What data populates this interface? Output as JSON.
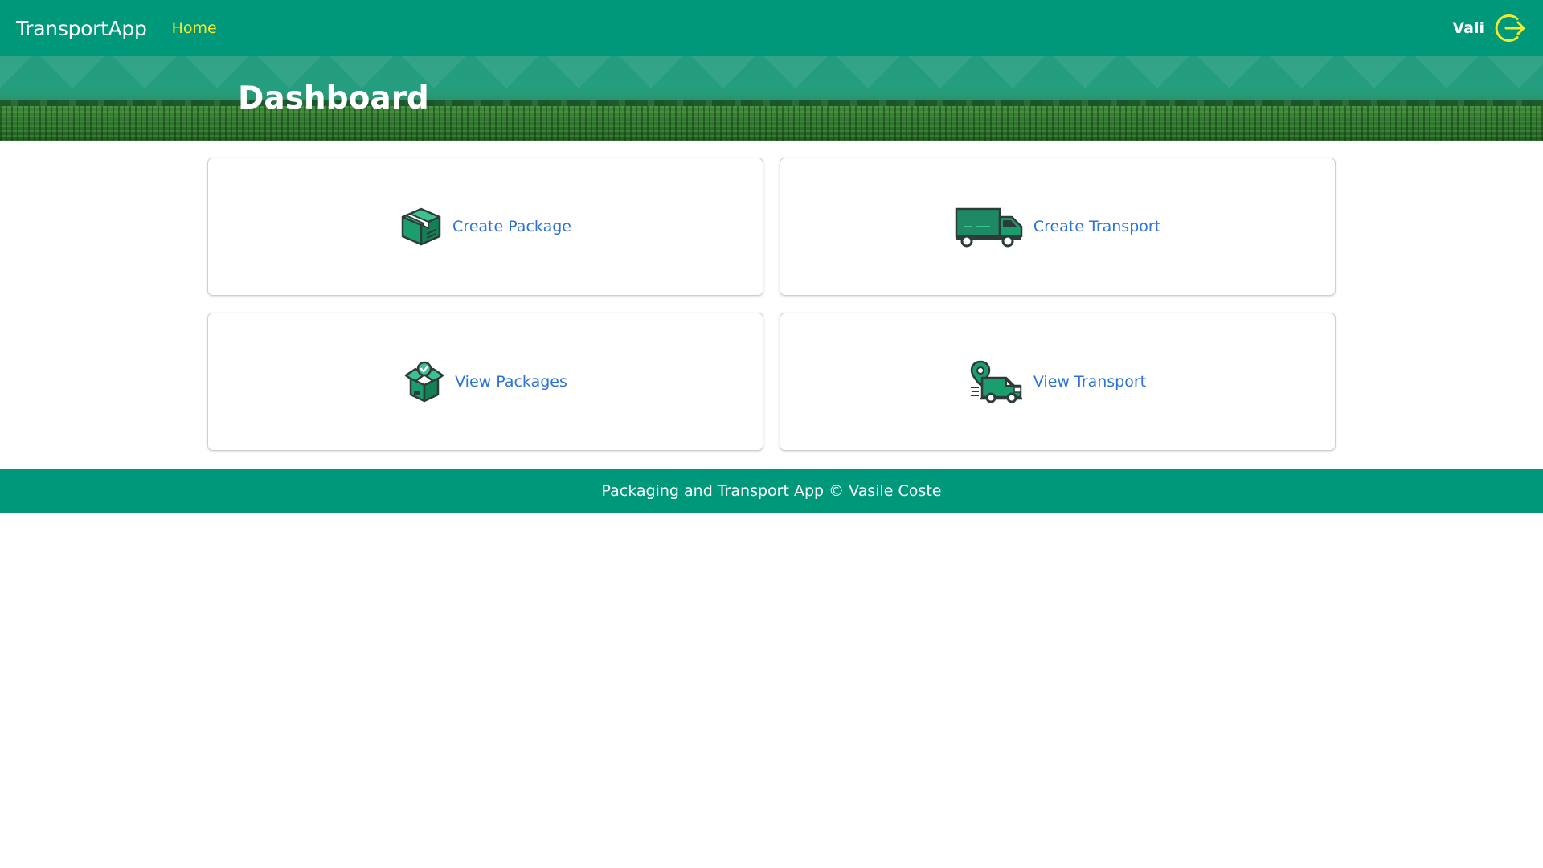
{
  "navbar": {
    "brand": "TransportApp",
    "home_label": "Home",
    "username": "Vali",
    "logout_icon": "logout-icon"
  },
  "hero": {
    "title": "Dashboard"
  },
  "cards": [
    {
      "label": "Create Package",
      "icon": "package-box-icon"
    },
    {
      "label": "Create Transport",
      "icon": "truck-icon"
    },
    {
      "label": "View Packages",
      "icon": "open-box-check-icon"
    },
    {
      "label": "View Transport",
      "icon": "delivery-van-location-icon"
    }
  ],
  "footer": {
    "text": "Packaging and Transport App © Vasile Coste"
  },
  "colors": {
    "primary": "#00987a",
    "nav_link": "#f2ea2e",
    "link": "#2c72d8",
    "icon_green": "#1d9a6c",
    "icon_dark": "#2d3b3a"
  }
}
